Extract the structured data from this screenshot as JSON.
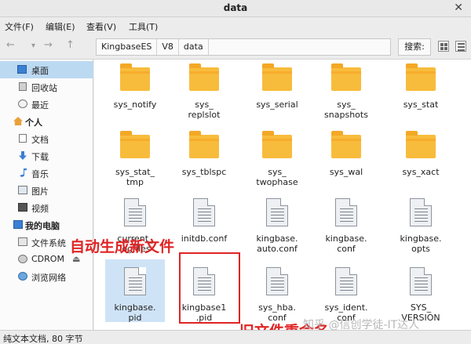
{
  "window": {
    "title": "data",
    "close_glyph": "✕"
  },
  "menu": [
    "文件(F)",
    "编辑(E)",
    "查看(V)",
    "工具(T)"
  ],
  "toolbar": {
    "back_glyph": "←",
    "forward_glyph": "→",
    "dropdown_glyph": "▾",
    "up_glyph": "↑",
    "breadcrumbs": [
      "KingbaseES",
      "V8",
      "data"
    ],
    "search_label": "搜索:"
  },
  "sidebar": {
    "desktop": "桌面",
    "trash": "回收站",
    "recent": "最近",
    "personal_group": "个人",
    "documents": "文档",
    "downloads": "下载",
    "music": "音乐",
    "pictures": "图片",
    "videos": "视频",
    "computer_group": "我的电脑",
    "filesystem": "文件系统",
    "cdrom": "CDROM",
    "network": "浏览网络",
    "eject_glyph": "⏏"
  },
  "files": [
    {
      "name_l1": "sys_notify",
      "name_l2": "",
      "type": "folder"
    },
    {
      "name_l1": "sys_",
      "name_l2": "replslot",
      "type": "folder"
    },
    {
      "name_l1": "sys_serial",
      "name_l2": "",
      "type": "folder"
    },
    {
      "name_l1": "sys_",
      "name_l2": "snapshots",
      "type": "folder"
    },
    {
      "name_l1": "sys_stat",
      "name_l2": "",
      "type": "folder"
    },
    {
      "name_l1": "sys_stat_",
      "name_l2": "tmp",
      "type": "folder"
    },
    {
      "name_l1": "sys_tblspc",
      "name_l2": "",
      "type": "folder"
    },
    {
      "name_l1": "sys_",
      "name_l2": "twophase",
      "type": "folder"
    },
    {
      "name_l1": "sys_wal",
      "name_l2": "",
      "type": "folder"
    },
    {
      "name_l1": "sys_xact",
      "name_l2": "",
      "type": "folder"
    },
    {
      "name_l1": "current_",
      "name_l2": "logfiles",
      "type": "doc"
    },
    {
      "name_l1": "initdb.conf",
      "name_l2": "",
      "type": "doc"
    },
    {
      "name_l1": "kingbase.",
      "name_l2": "auto.conf",
      "type": "doc"
    },
    {
      "name_l1": "kingbase.",
      "name_l2": "conf",
      "type": "doc"
    },
    {
      "name_l1": "kingbase.",
      "name_l2": "opts",
      "type": "doc"
    },
    {
      "name_l1": "kingbase.",
      "name_l2": "pid",
      "type": "doc",
      "selected": true
    },
    {
      "name_l1": "kingbase1",
      "name_l2": ".pid",
      "type": "doc"
    },
    {
      "name_l1": "sys_hba.",
      "name_l2": "conf",
      "type": "doc"
    },
    {
      "name_l1": "sys_ident.",
      "name_l2": "conf",
      "type": "doc"
    },
    {
      "name_l1": "SYS_",
      "name_l2": "VERSION",
      "type": "doc"
    }
  ],
  "status_text": "纯文本文档, 80 字节",
  "annotations": {
    "new_file": "自动生成新文件",
    "old_file": "旧文件重命名"
  },
  "watermark": "知乎 @信创学徒-IT达人",
  "colors": {
    "annotation": "#e02424",
    "folder": "#f8bc3c",
    "selection": "#bcd9f2"
  }
}
